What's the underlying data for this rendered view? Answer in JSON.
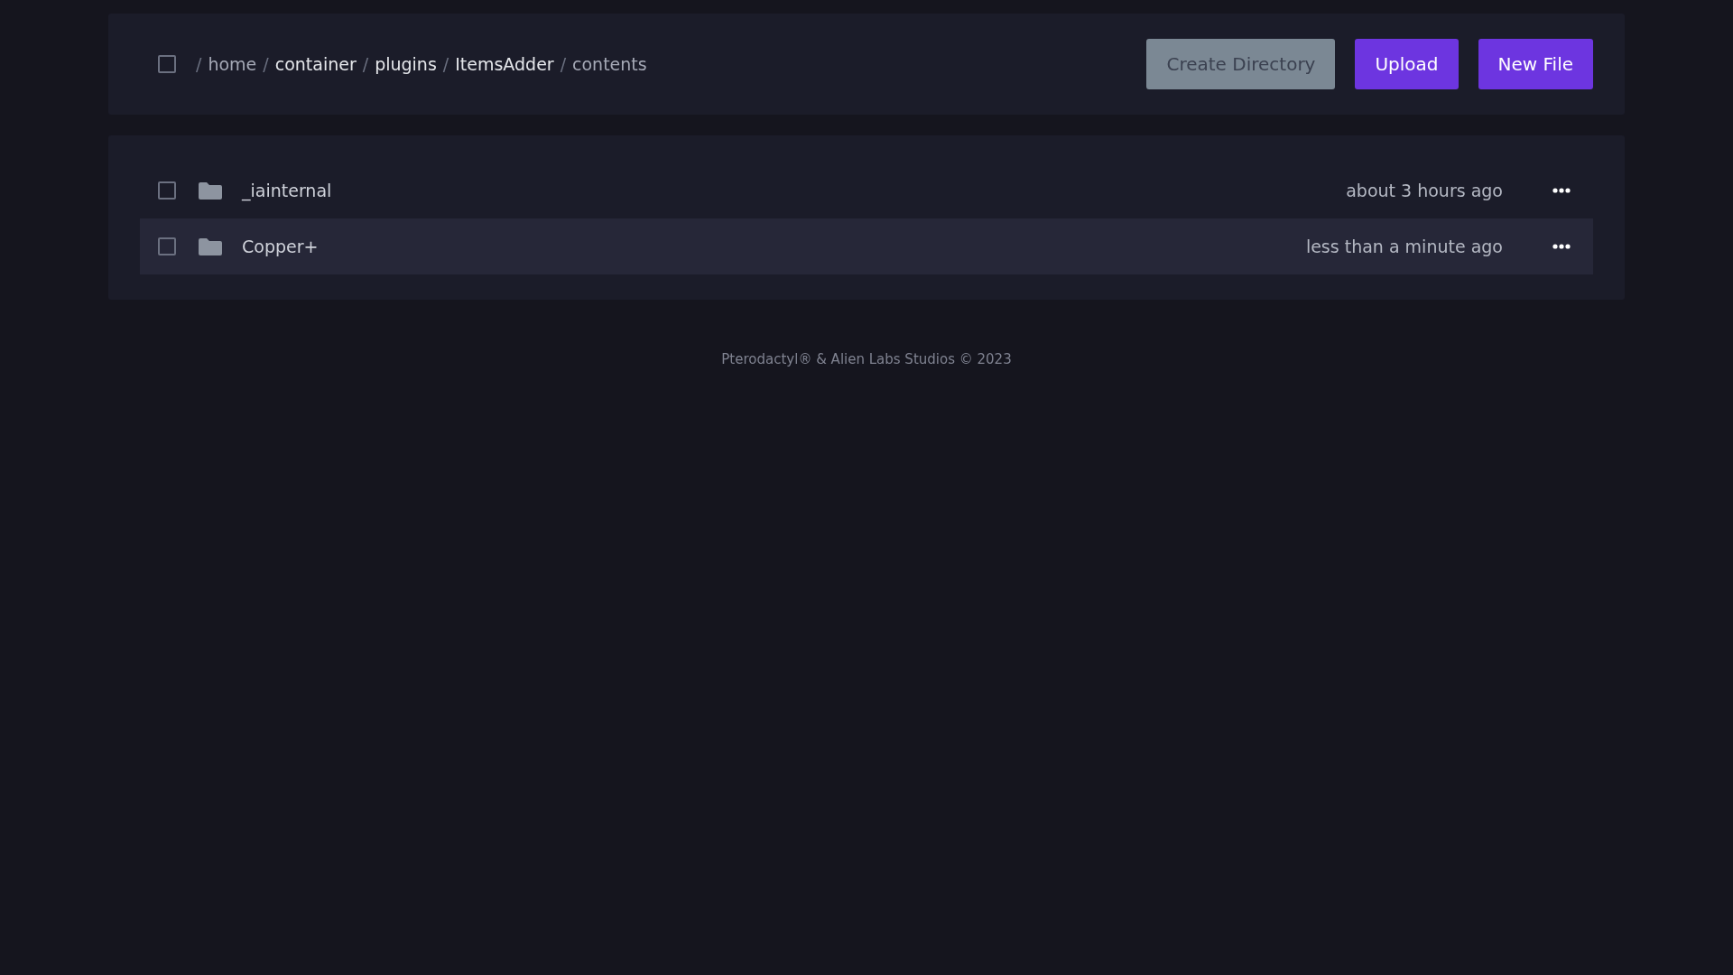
{
  "toolbar": {
    "select_all": {
      "checked": false
    },
    "breadcrumb": [
      {
        "label": "home",
        "link": false
      },
      {
        "label": "container",
        "link": true
      },
      {
        "label": "plugins",
        "link": true
      },
      {
        "label": "ItemsAdder",
        "link": true
      },
      {
        "label": "contents",
        "link": false
      }
    ],
    "separator": "/",
    "buttons": [
      {
        "label": "Create Directory",
        "kind": "secondary"
      },
      {
        "label": "Upload",
        "kind": "primary"
      },
      {
        "label": "New File",
        "kind": "primary"
      }
    ]
  },
  "files": [
    {
      "name": "_iainternal",
      "modified": "about 3 hours ago",
      "checked": false,
      "hovered": false
    },
    {
      "name": "Copper+",
      "modified": "less than a minute ago",
      "checked": false,
      "hovered": true
    }
  ],
  "footer": "Pterodactyl® & Alien Labs Studios © 2023"
}
